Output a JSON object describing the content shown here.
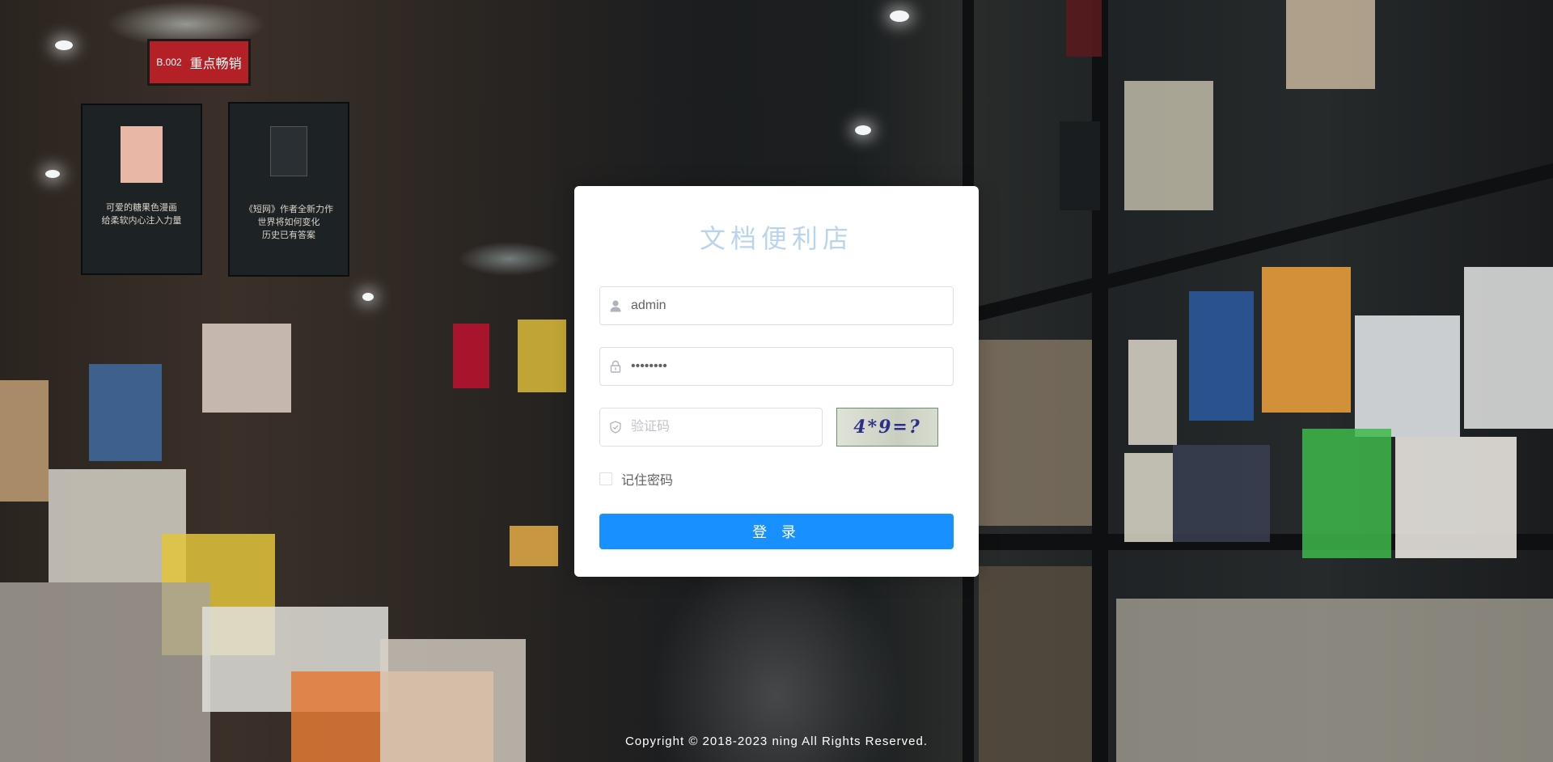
{
  "background": {
    "sign_code": "B.002",
    "sign_text": "重点畅销",
    "poster_left_lines": [
      "可爱的糖果色漫画",
      "给柔软内心注入力量"
    ],
    "poster_right_lines": [
      "《短网》作者全新力作",
      "世界将如何变化",
      "历史已有答案"
    ]
  },
  "login": {
    "title": "文档便利店",
    "username_value": "admin",
    "password_value": "12345678",
    "captcha_placeholder": "验证码",
    "captcha_text": "4*9=?",
    "remember_label": "记住密码",
    "login_button": "登 录"
  },
  "footer": {
    "copyright": "Copyright © 2018-2023 ning All Rights Reserved."
  },
  "colors": {
    "primary": "#1890ff",
    "title": "#b9d5ee"
  }
}
